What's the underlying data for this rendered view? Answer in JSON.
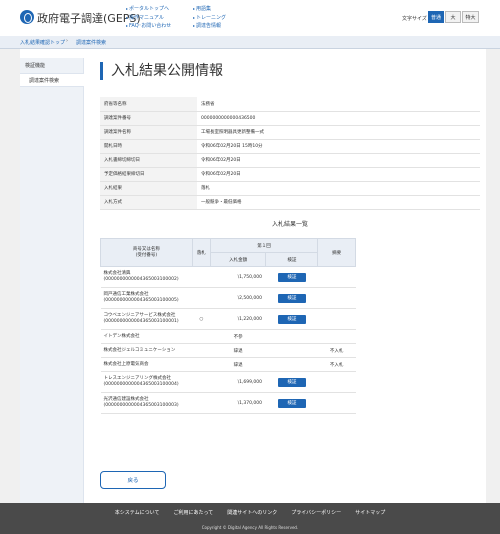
{
  "header": {
    "site_title": "政府電子調達(GEPS)",
    "links_col1": [
      "ポータルトップへ",
      "操作マニュアル",
      "FAQ･お問い合わせ"
    ],
    "links_col2": [
      "用語集",
      "トレーニング",
      "調達告情報"
    ],
    "fontsize_label": "文字サイズ",
    "fontsize_options": [
      "普通",
      "大",
      "特大"
    ],
    "fontsize_selected": "普通"
  },
  "breadcrumb": [
    "入札結果確認トップ",
    "調達案件検索"
  ],
  "sidebar": {
    "section": "検証機能",
    "items": [
      "調達案件検索"
    ]
  },
  "main": {
    "title": "入札結果公開情報",
    "info": [
      {
        "label": "府省等名称",
        "value": "法務省"
      },
      {
        "label": "調達案件番号",
        "value": "0000000000000436500"
      },
      {
        "label": "調達案件名称",
        "value": "工場長室照明器具更新整備一式"
      },
      {
        "label": "開札日時",
        "value": "令和06年02月20日 15時10分"
      },
      {
        "label": "入札書締切締切日",
        "value": "令和06年02月20日"
      },
      {
        "label": "予定価格結果締切日",
        "value": "令和06年02月20日"
      },
      {
        "label": "入札結果",
        "value": "落札"
      },
      {
        "label": "入札方式",
        "value": "一般競争・最低価格"
      }
    ],
    "results_title": "入札結果一覧",
    "results_headers": {
      "name": "商号又は名称\n(受付番号)",
      "award": "落札",
      "round": "第１回",
      "amount": "入札金額",
      "verify": "検証",
      "remarks": "摘要"
    },
    "results": [
      {
        "name": "株式会社清興",
        "id": "(0000000000004365003100002)",
        "award": "",
        "amount": "\\1,750,000",
        "verify": "検証",
        "remarks": ""
      },
      {
        "name": "岡戸通信工業株式会社",
        "id": "(0000000000004365003100005)",
        "award": "",
        "amount": "\\2,500,000",
        "verify": "検証",
        "remarks": ""
      },
      {
        "name": "コウベエンジニアサービス株式会社",
        "id": "(0000000000004365003100001)",
        "award": "○",
        "amount": "\\1,220,000",
        "verify": "検証",
        "remarks": ""
      },
      {
        "name": "イトデン株式会社",
        "id": "",
        "award": "",
        "amount": "不参",
        "verify": "",
        "remarks": ""
      },
      {
        "name": "株式会社ジェルコミュニケーション",
        "id": "",
        "award": "",
        "amount": "辞退",
        "verify": "",
        "remarks": "不入札"
      },
      {
        "name": "株式会社上原電気商会",
        "id": "",
        "award": "",
        "amount": "辞退",
        "verify": "",
        "remarks": "不入札"
      },
      {
        "name": "トレスエンジニアリング株式会社",
        "id": "(0000000000004365003100004)",
        "award": "",
        "amount": "\\1,699,000",
        "verify": "検証",
        "remarks": ""
      },
      {
        "name": "光沢通信建設株式会社",
        "id": "(0000000000004365003100003)",
        "award": "",
        "amount": "\\1,370,000",
        "verify": "検証",
        "remarks": ""
      }
    ],
    "back_label": "戻る"
  },
  "footer": {
    "links": [
      "本システムについて",
      "ご利用にあたって",
      "関連サイトへのリンク",
      "プライバシーポリシー",
      "サイトマップ"
    ],
    "copyright": "Copyright © Digital Agency All Rights Reserved."
  }
}
